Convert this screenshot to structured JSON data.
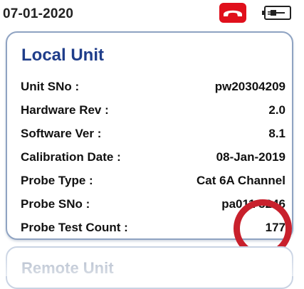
{
  "status_bar": {
    "date": "07-01-2020",
    "call_icon": "phone-hangup-icon",
    "battery_icon": "battery-plug-icon",
    "call_color": "#e0101c"
  },
  "local_unit": {
    "title": "Local Unit",
    "rows": [
      {
        "label": "Unit SNo :",
        "value": "pw20304209"
      },
      {
        "label": "Hardware Rev :",
        "value": "2.0"
      },
      {
        "label": "Software Ver :",
        "value": "8.1"
      },
      {
        "label": "Calibration Date :",
        "value": "08-Jan-2019"
      },
      {
        "label": "Probe Type :",
        "value": "Cat 6A Channel"
      },
      {
        "label": "Probe SNo  :",
        "value": "pa011 3246"
      },
      {
        "label": "Probe Test Count :",
        "value": "177"
      }
    ],
    "title_color": "#1f3d8a",
    "border_color": "#8fa3c2"
  },
  "remote_unit": {
    "title": "Remote Unit"
  },
  "annotation": {
    "highlight_color": "#c8202c"
  }
}
